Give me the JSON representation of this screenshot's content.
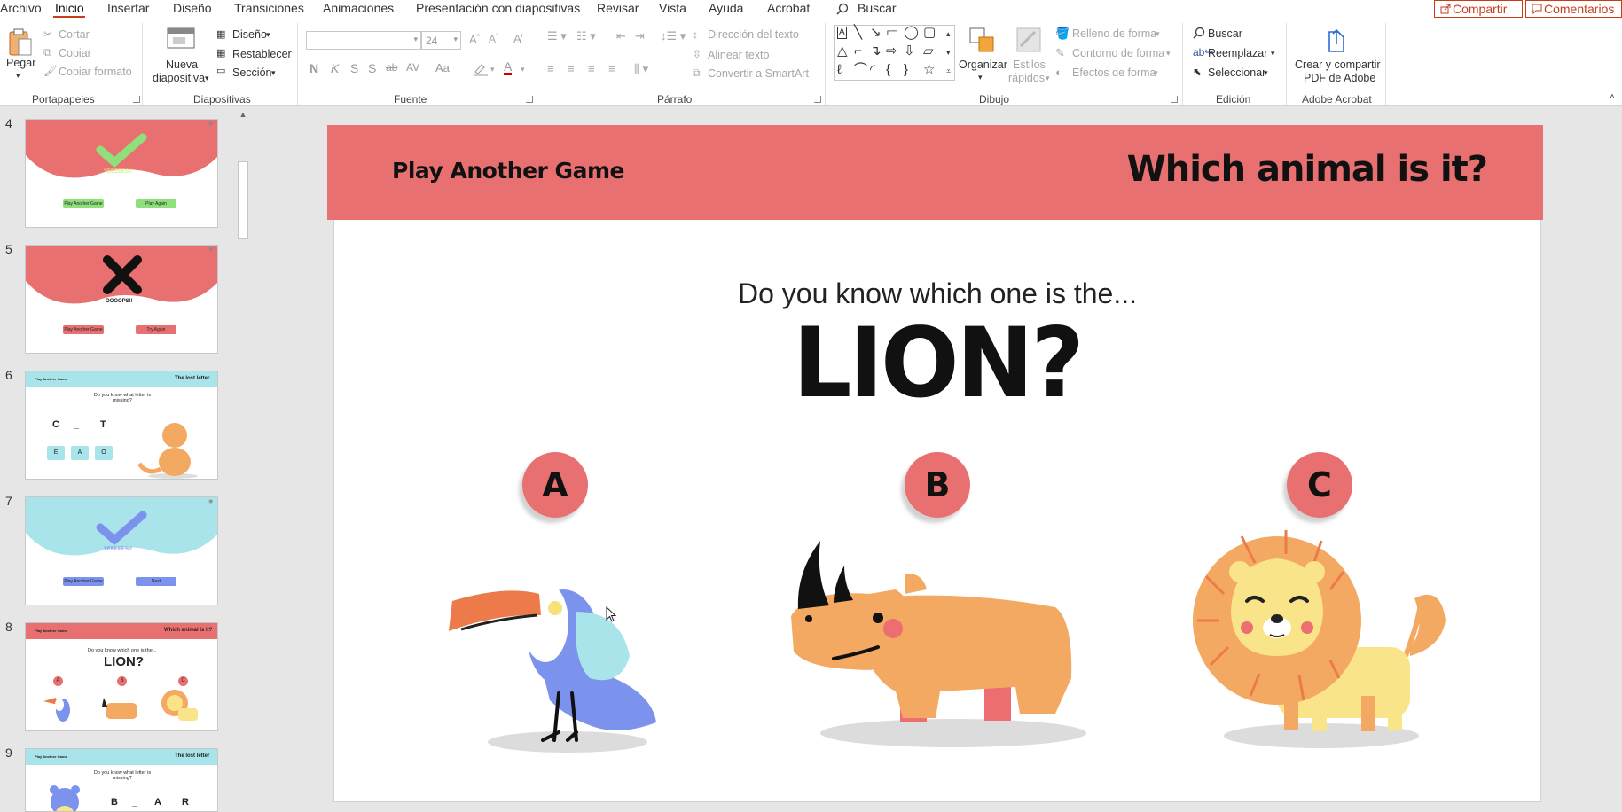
{
  "menu": {
    "items": [
      "Archivo",
      "Inicio",
      "Insertar",
      "Diseño",
      "Transiciones",
      "Animaciones",
      "Presentación con diapositivas",
      "Revisar",
      "Vista",
      "Ayuda",
      "Acrobat"
    ],
    "search": "Buscar",
    "share": "Compartir",
    "comments": "Comentarios"
  },
  "ribbon": {
    "clipboard": {
      "paste": "Pegar",
      "cut": "Cortar",
      "copy": "Copiar",
      "format_painter": "Copiar formato",
      "label": "Portapapeles"
    },
    "slides": {
      "new_slide_1": "Nueva",
      "new_slide_2": "diapositiva",
      "layout": "Diseño",
      "reset": "Restablecer",
      "section": "Sección",
      "label": "Diapositivas"
    },
    "font": {
      "size": "24",
      "label": "Fuente",
      "bold": "N",
      "italic": "K",
      "underline": "S",
      "shadow": "S",
      "strike": "ab",
      "spacing": "AV",
      "case": "Aa"
    },
    "paragraph": {
      "text_direction": "Dirección del texto",
      "align_text": "Alinear texto",
      "smartart": "Convertir a SmartArt",
      "label": "Párrafo"
    },
    "drawing": {
      "arrange": "Organizar",
      "quick_styles_1": "Estilos",
      "quick_styles_2": "rápidos",
      "fill": "Relleno de forma",
      "outline": "Contorno de forma",
      "effects": "Efectos de forma",
      "label": "Dibujo"
    },
    "editing": {
      "find": "Buscar",
      "replace": "Reemplazar",
      "select": "Seleccionar",
      "label": "Edición"
    },
    "acrobat": {
      "create_1": "Crear y compartir",
      "create_2": "PDF de Adobe",
      "label": "Adobe Acrobat"
    }
  },
  "thumbnails": [
    {
      "number": "4",
      "caption": "YEEEEES!!",
      "btn1": "Play Another Game",
      "btn2": "Play Again"
    },
    {
      "number": "5",
      "caption": "OOOOPS!!",
      "btn1": "Play Another Game",
      "btn2": "Try Again"
    },
    {
      "number": "6",
      "header_left": "Play Another Game",
      "header_right": "The lost letter",
      "question": "Do you know what letter is missing?",
      "letters": [
        "C",
        "_",
        "T"
      ],
      "options": [
        "E",
        "A",
        "O"
      ]
    },
    {
      "number": "7",
      "caption": "YEEEEES!!",
      "btn1": "Play Another Game",
      "btn2": "Next"
    },
    {
      "number": "8",
      "header_left": "Play Another Game",
      "header_right": "Which animal is it?",
      "question": "Do you know which one is the...",
      "answer": "LION?",
      "options": [
        "A",
        "B",
        "C"
      ]
    },
    {
      "number": "9",
      "header_left": "Play Another Game",
      "header_right": "The lost letter",
      "question": "Do you know what letter is missing?",
      "letters": [
        "B",
        "_",
        "A",
        "R"
      ]
    }
  ],
  "slide": {
    "header_left": "Play Another Game",
    "header_right": "Which animal is it?",
    "question": "Do you know which one is the...",
    "answer": "LION?",
    "options": [
      "A",
      "B",
      "C"
    ]
  },
  "colors": {
    "accent_red": "#e87070",
    "accent_cyan": "#a8e4ea",
    "accent_blue": "#7b93ec",
    "office_orange": "#c43e1c"
  }
}
